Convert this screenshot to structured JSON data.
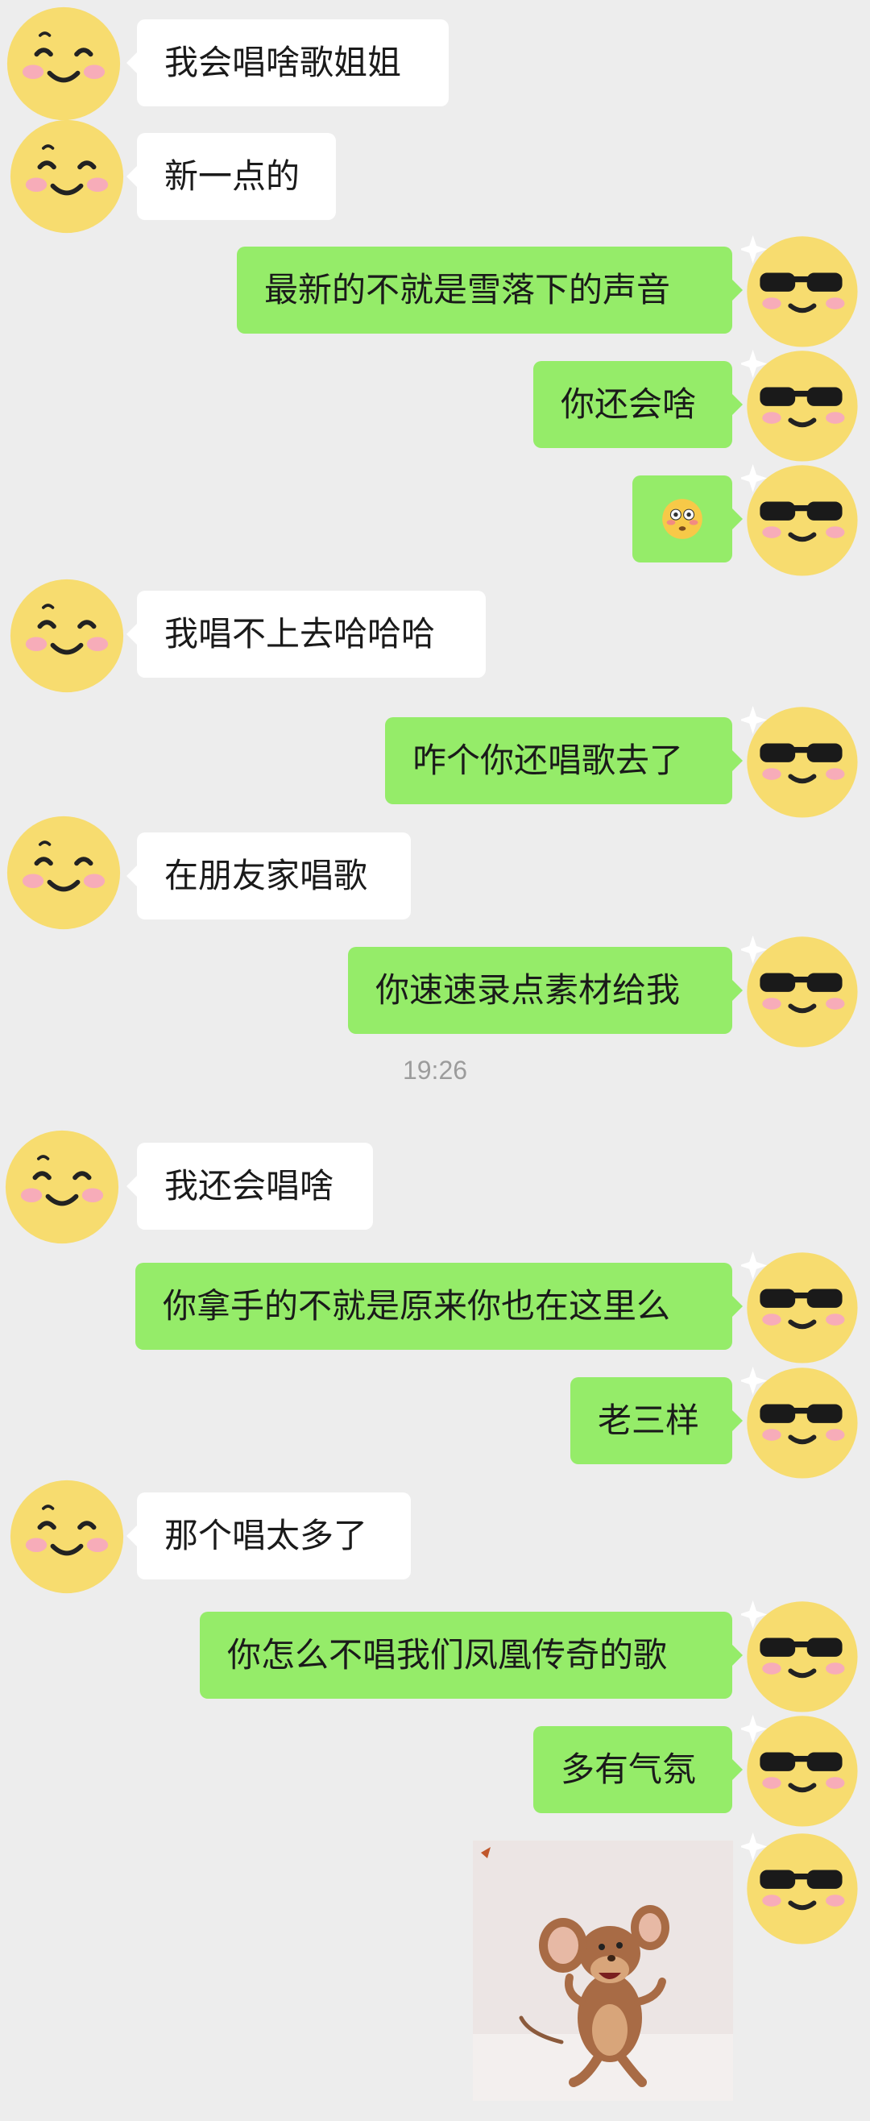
{
  "messages": [
    {
      "side": "in",
      "text": "我会唱啥歌姐姐"
    },
    {
      "side": "in",
      "text": "新一点的"
    },
    {
      "side": "out",
      "text": "最新的不就是雪落下的声音"
    },
    {
      "side": "out",
      "text": "你还会啥"
    },
    {
      "side": "out",
      "emoji": "flushed-face-emoji",
      "text": "😳"
    },
    {
      "side": "in",
      "text": "我唱不上去哈哈哈"
    },
    {
      "side": "out",
      "text": "咋个你还唱歌去了"
    },
    {
      "side": "in",
      "text": "在朋友家唱歌"
    },
    {
      "side": "out",
      "text": "你速速录点素材给我"
    },
    {
      "side": "in",
      "text": "我还会唱啥"
    },
    {
      "side": "out",
      "text": "你拿手的不就是原来你也在这里么"
    },
    {
      "side": "out",
      "text": "老三样"
    },
    {
      "side": "in",
      "text": "那个唱太多了"
    },
    {
      "side": "out",
      "text": "你怎么不唱我们凤凰传奇的歌"
    },
    {
      "side": "out",
      "text": "多有气氛"
    },
    {
      "side": "out",
      "sticker": "jerry-mouse-dancing-sticker"
    }
  ],
  "timestamp": "19:26",
  "colors": {
    "background": "#ededed",
    "incoming_bubble": "#ffffff",
    "outgoing_bubble": "#95ec69",
    "avatar_face": "#f7dc6f",
    "timestamp": "#9c9c9c"
  },
  "avatars": {
    "incoming": "smiling-emoji-avatar-icon",
    "outgoing": "sunglasses-emoji-avatar-icon"
  }
}
